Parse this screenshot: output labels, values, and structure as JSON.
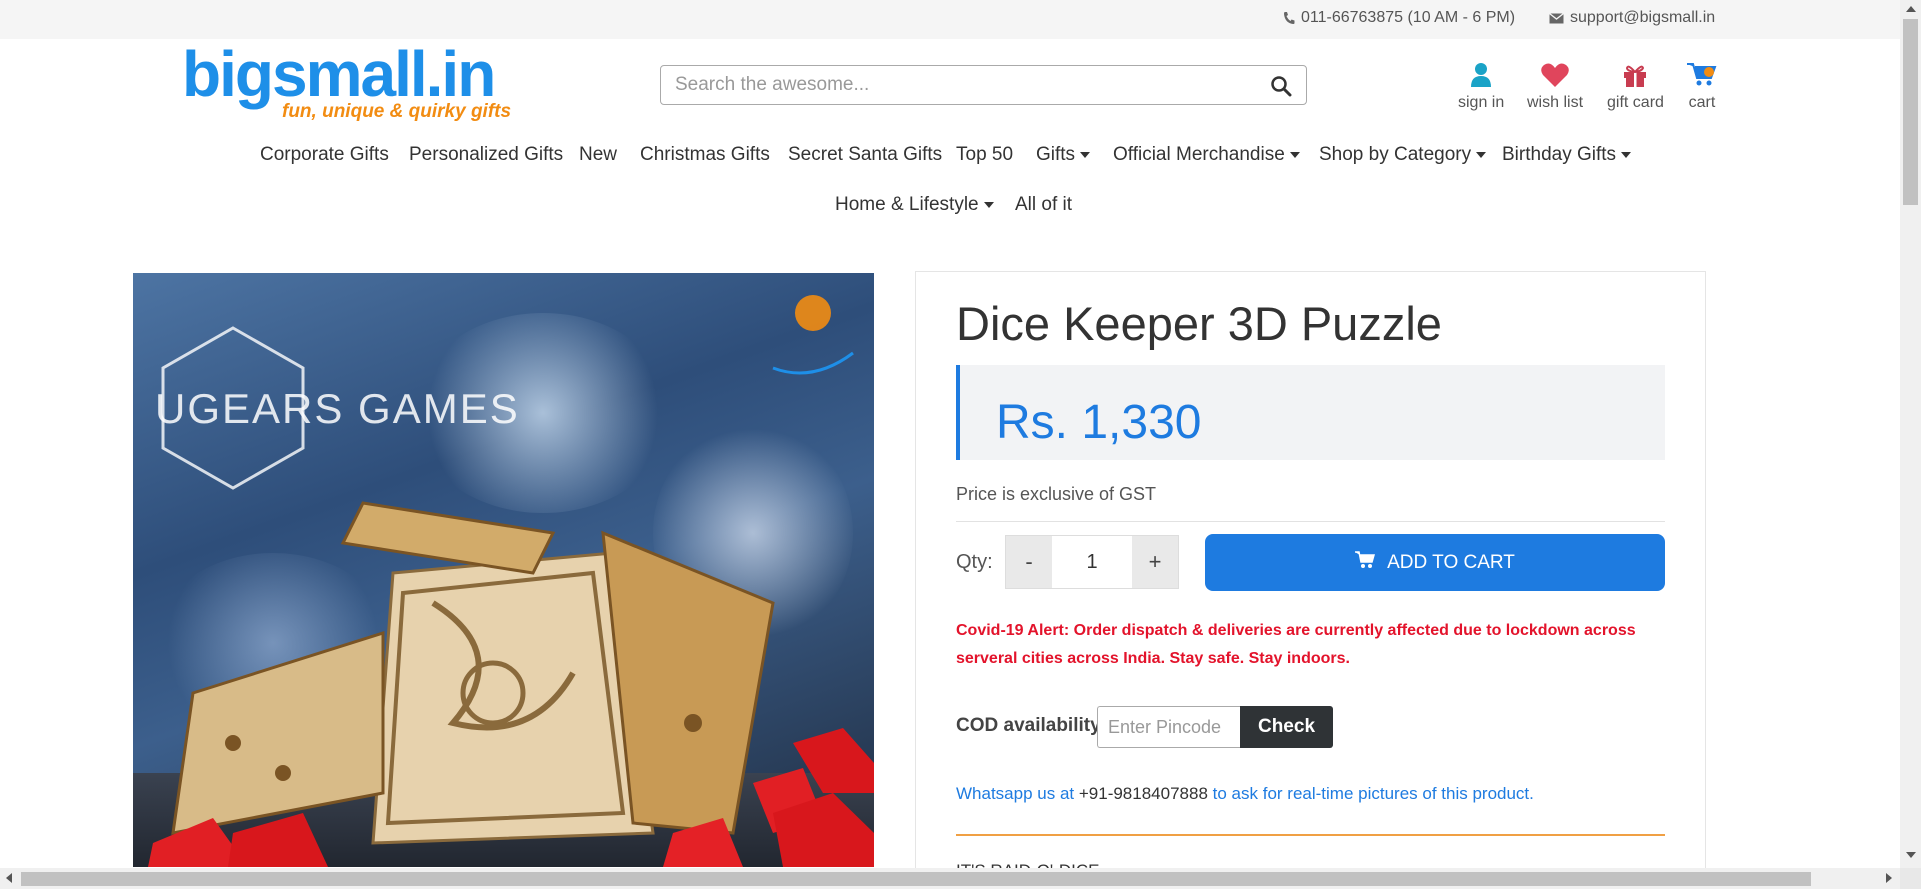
{
  "topbar": {
    "phone": "011-66763875 (10 AM - 6 PM)",
    "email": "support@bigsmall.in"
  },
  "logo": {
    "brand": "bigsmall.in",
    "tagline": "fun, unique & quirky gifts",
    "color": "#1e8fe8",
    "tagline_color": "#f28c12"
  },
  "search": {
    "placeholder": "Search the awesome..."
  },
  "header_icons": {
    "sign_in": "sign in",
    "wish_list": "wish list",
    "gift_card": "gift card",
    "cart": "cart"
  },
  "nav": {
    "items": [
      {
        "label": "Corporate Gifts",
        "dropdown": false
      },
      {
        "label": "Personalized Gifts",
        "dropdown": false
      },
      {
        "label": "New",
        "dropdown": false
      },
      {
        "label": "Christmas Gifts",
        "dropdown": false
      },
      {
        "label": "Secret Santa Gifts",
        "dropdown": false
      },
      {
        "label": "Top 50",
        "dropdown": false
      },
      {
        "label": "Gifts",
        "dropdown": true
      },
      {
        "label": "Official Merchandise",
        "dropdown": true
      },
      {
        "label": "Shop by Category",
        "dropdown": true
      },
      {
        "label": "Birthday Gifts",
        "dropdown": true
      },
      {
        "label": "Home & Lifestyle",
        "dropdown": true
      },
      {
        "label": "All of it",
        "dropdown": false
      }
    ]
  },
  "product": {
    "image_watermark": "UGEARS GAMES",
    "title": "Dice Keeper 3D Puzzle",
    "price": "Rs. 1,330",
    "gst_note": "Price is exclusive of GST",
    "qty_label": "Qty:",
    "qty_minus": "-",
    "qty_value": "1",
    "qty_plus": "+",
    "add_to_cart": "ADD TO CART",
    "covid_alert": "Covid-19 Alert: Order dispatch & deliveries are currently affected due to lockdown across serveral cities across India. Stay safe. Stay indoors.",
    "cod_label": "COD availability",
    "pincode_placeholder": "Enter Pincode",
    "check_label": "Check",
    "whatsapp_prefix": "Whatsapp us at",
    "whatsapp_number": "+91-9818407888",
    "whatsapp_suffix": "to ask for real-time pictures of this product.",
    "next_heading": "IT'S RAID-O'-DICE"
  },
  "colors": {
    "accent": "#1e7be0",
    "alert": "#e3132b",
    "divider_orange": "#f0a044",
    "heart": "#e0455c",
    "gift": "#c83c50",
    "user_icon": "#1aa3c7"
  }
}
